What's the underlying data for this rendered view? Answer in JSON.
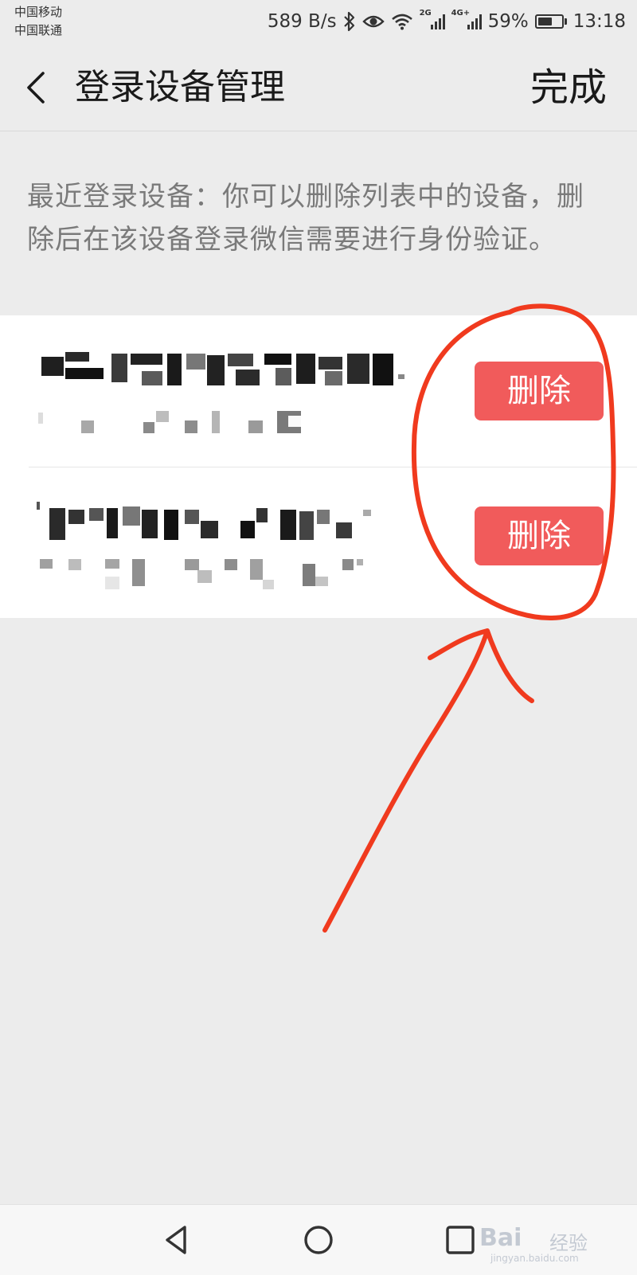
{
  "status_bar": {
    "carrier_1": "中国移动",
    "carrier_2": "中国联通",
    "net_speed": "589 B/s",
    "signal_1_tag": "2G",
    "signal_2_tag": "4G+",
    "battery_percent": "59%",
    "battery_level": 0.59,
    "time": "13:18",
    "icons": [
      "bluetooth-icon",
      "eye-icon",
      "wifi-icon",
      "signal-icon",
      "signal-icon",
      "battery-icon"
    ]
  },
  "nav": {
    "title": "登录设备管理",
    "done_label": "完成",
    "back_icon": "chevron-left-icon"
  },
  "description": "最近登录设备：你可以删除列表中的设备，删除后在该设备登录微信需要进行身份验证。",
  "devices": [
    {
      "delete_label": "删除"
    },
    {
      "delete_label": "删除"
    }
  ],
  "annotation_color": "#f03a1e",
  "accent_red": "#f15b5b",
  "bottom_nav": {
    "icons": [
      "back-triangle-icon",
      "home-circle-icon",
      "recents-square-icon"
    ]
  },
  "watermark": {
    "brand": "Bai",
    "name": "经验",
    "url": "jingyan.baidu.com"
  }
}
